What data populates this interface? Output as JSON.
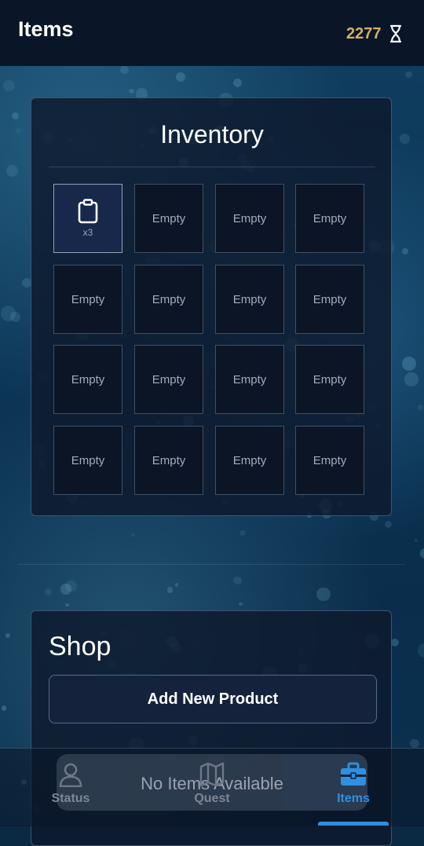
{
  "header": {
    "title": "Items",
    "timer_value": "2277",
    "timer_icon": "hourglass-icon"
  },
  "inventory": {
    "title": "Inventory",
    "slots": [
      {
        "label": "",
        "icon": "clipboard-icon",
        "quantity": "x3"
      },
      {
        "label": "Empty"
      },
      {
        "label": "Empty"
      },
      {
        "label": "Empty"
      },
      {
        "label": "Empty"
      },
      {
        "label": "Empty"
      },
      {
        "label": "Empty"
      },
      {
        "label": "Empty"
      },
      {
        "label": "Empty"
      },
      {
        "label": "Empty"
      },
      {
        "label": "Empty"
      },
      {
        "label": "Empty"
      },
      {
        "label": "Empty"
      },
      {
        "label": "Empty"
      },
      {
        "label": "Empty"
      },
      {
        "label": "Empty"
      }
    ]
  },
  "shop": {
    "title": "Shop",
    "add_button_label": "Add New Product",
    "empty_message": "No Items Available"
  },
  "bottom_nav": {
    "items": [
      {
        "label": "Status",
        "icon": "person-icon",
        "active": false
      },
      {
        "label": "Quest",
        "icon": "map-icon",
        "active": false
      },
      {
        "label": "Items",
        "icon": "toolbox-icon",
        "active": true
      }
    ]
  },
  "colors": {
    "accent": "#2f8fe0",
    "timer": "#d4b062",
    "topbar": "#0a1628"
  }
}
